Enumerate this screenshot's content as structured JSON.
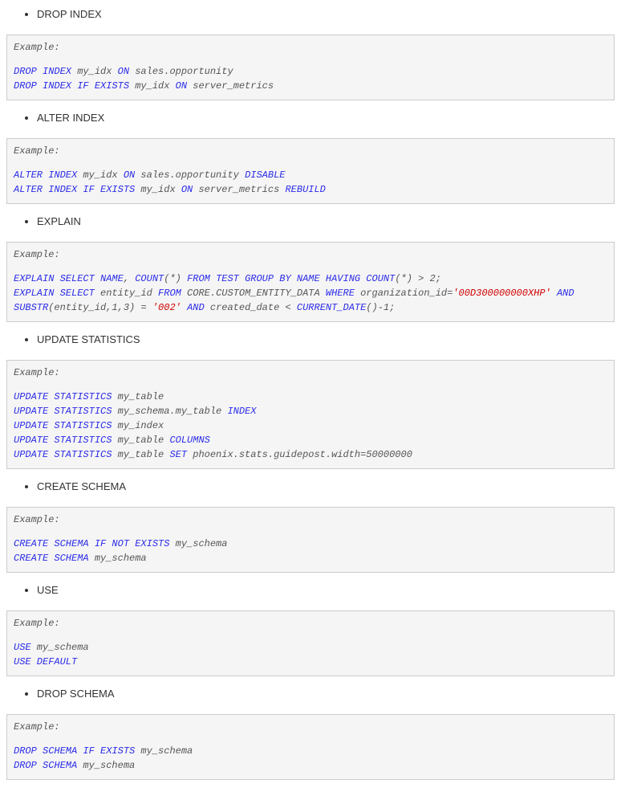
{
  "sections": [
    {
      "title": "DROP INDEX",
      "example_label": "Example:",
      "lines": [
        [
          [
            "kw",
            "DROP INDEX"
          ],
          [
            "plain",
            " my_idx "
          ],
          [
            "kw",
            "ON"
          ],
          [
            "plain",
            " sales.opportunity"
          ]
        ],
        [
          [
            "kw",
            "DROP INDEX IF EXISTS"
          ],
          [
            "plain",
            " my_idx "
          ],
          [
            "kw",
            "ON"
          ],
          [
            "plain",
            " server_metrics"
          ]
        ]
      ]
    },
    {
      "title": "ALTER INDEX",
      "example_label": "Example:",
      "lines": [
        [
          [
            "kw",
            "ALTER INDEX"
          ],
          [
            "plain",
            " my_idx "
          ],
          [
            "kw",
            "ON"
          ],
          [
            "plain",
            " sales.opportunity "
          ],
          [
            "kw",
            "DISABLE"
          ]
        ],
        [
          [
            "kw",
            "ALTER INDEX IF EXISTS"
          ],
          [
            "plain",
            " my_idx "
          ],
          [
            "kw",
            "ON"
          ],
          [
            "plain",
            " server_metrics "
          ],
          [
            "kw",
            "REBUILD"
          ]
        ]
      ]
    },
    {
      "title": "EXPLAIN",
      "example_label": "Example:",
      "lines": [
        [
          [
            "kw",
            "EXPLAIN SELECT NAME"
          ],
          [
            "plain",
            ", "
          ],
          [
            "kw",
            "COUNT"
          ],
          [
            "plain",
            "(*) "
          ],
          [
            "kw",
            "FROM TEST GROUP BY NAME HAVING COUNT"
          ],
          [
            "plain",
            "(*) > 2;"
          ]
        ],
        [
          [
            "kw",
            "EXPLAIN SELECT"
          ],
          [
            "plain",
            " entity_id "
          ],
          [
            "kw",
            "FROM"
          ],
          [
            "plain",
            " CORE.CUSTOM_ENTITY_DATA "
          ],
          [
            "kw",
            "WHERE"
          ],
          [
            "plain",
            " organization_id="
          ],
          [
            "str",
            "'00D300000000XHP'"
          ],
          [
            "plain",
            " "
          ],
          [
            "kw",
            "AND"
          ],
          [
            "plain",
            " "
          ],
          [
            "kw",
            "SUBSTR"
          ],
          [
            "plain",
            "(entity_id,1,3) = "
          ],
          [
            "str",
            "'002'"
          ],
          [
            "plain",
            " "
          ],
          [
            "kw",
            "AND"
          ],
          [
            "plain",
            " created_date < "
          ],
          [
            "kw",
            "CURRENT_DATE"
          ],
          [
            "plain",
            "()-1;"
          ]
        ]
      ]
    },
    {
      "title": "UPDATE STATISTICS",
      "example_label": "Example:",
      "lines": [
        [
          [
            "kw",
            "UPDATE STATISTICS"
          ],
          [
            "plain",
            " my_table"
          ]
        ],
        [
          [
            "kw",
            "UPDATE STATISTICS"
          ],
          [
            "plain",
            " my_schema.my_table "
          ],
          [
            "kw",
            "INDEX"
          ]
        ],
        [
          [
            "kw",
            "UPDATE STATISTICS"
          ],
          [
            "plain",
            " my_index"
          ]
        ],
        [
          [
            "kw",
            "UPDATE STATISTICS"
          ],
          [
            "plain",
            " my_table "
          ],
          [
            "kw",
            "COLUMNS"
          ]
        ],
        [
          [
            "kw",
            "UPDATE STATISTICS"
          ],
          [
            "plain",
            " my_table "
          ],
          [
            "kw",
            "SET"
          ],
          [
            "plain",
            " phoenix.stats.guidepost.width=50000000"
          ]
        ]
      ]
    },
    {
      "title": "CREATE SCHEMA",
      "example_label": "Example:",
      "lines": [
        [
          [
            "kw",
            "CREATE SCHEMA IF NOT EXISTS"
          ],
          [
            "plain",
            " my_schema"
          ]
        ],
        [
          [
            "kw",
            "CREATE SCHEMA"
          ],
          [
            "plain",
            " my_schema"
          ]
        ]
      ]
    },
    {
      "title": "USE",
      "example_label": "Example:",
      "lines": [
        [
          [
            "kw",
            "USE"
          ],
          [
            "plain",
            " my_schema"
          ]
        ],
        [
          [
            "kw",
            "USE DEFAULT"
          ]
        ]
      ]
    },
    {
      "title": "DROP SCHEMA",
      "example_label": "Example:",
      "lines": [
        [
          [
            "kw",
            "DROP SCHEMA IF EXISTS"
          ],
          [
            "plain",
            " my_schema"
          ]
        ],
        [
          [
            "kw",
            "DROP SCHEMA"
          ],
          [
            "plain",
            " my_schema"
          ]
        ]
      ]
    }
  ]
}
